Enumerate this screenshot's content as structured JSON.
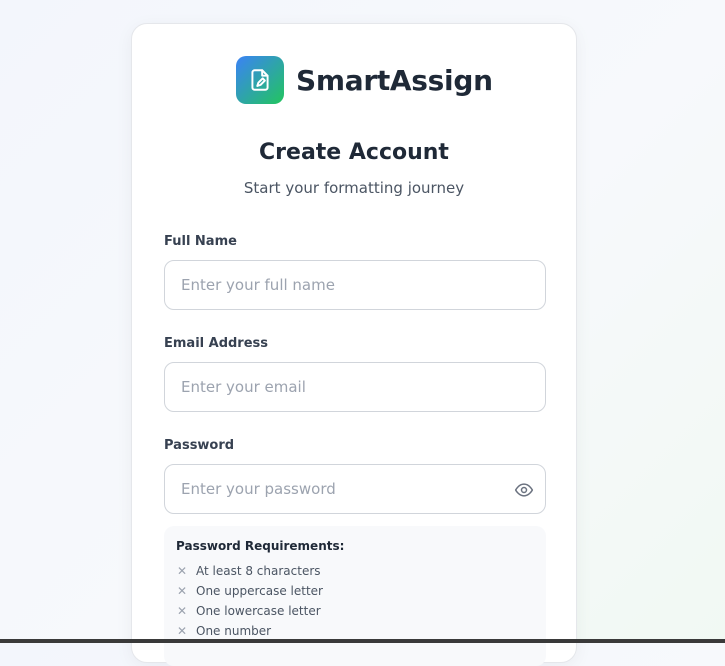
{
  "brand": {
    "name": "SmartAssign",
    "logo_icon": "document-pen-icon",
    "logo_gradient": [
      "#3b82f6",
      "#22c55e"
    ]
  },
  "header": {
    "title": "Create Account",
    "subtitle": "Start your formatting journey"
  },
  "form": {
    "full_name": {
      "label": "Full Name",
      "value": "",
      "placeholder": "Enter your full name"
    },
    "email": {
      "label": "Email Address",
      "value": "",
      "placeholder": "Enter your email"
    },
    "password": {
      "label": "Password",
      "value": "",
      "placeholder": "Enter your password",
      "toggle_icon": "eye-icon"
    }
  },
  "requirements": {
    "title": "Password Requirements:",
    "status_icon": "x-icon",
    "items": [
      "At least 8 characters",
      "One uppercase letter",
      "One lowercase letter",
      "One number"
    ]
  }
}
